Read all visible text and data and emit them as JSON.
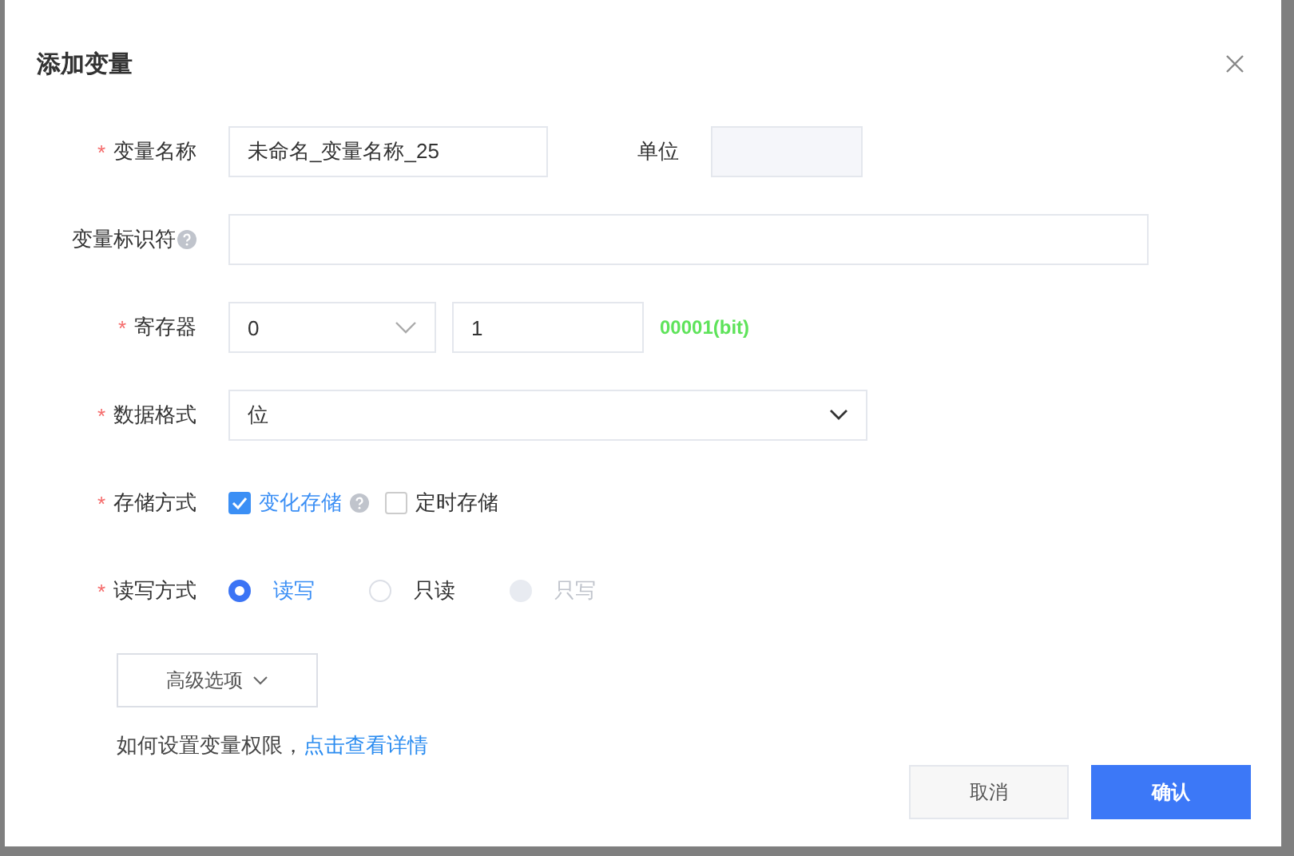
{
  "title": "添加变量",
  "rows": [
    {
      "kind": "text-unit",
      "label": "变量名称",
      "required_mark": "*",
      "value": "未命名_变量名称_25",
      "unit_label": "单位"
    },
    {
      "kind": "text",
      "label": "变量标识符",
      "help": true
    },
    {
      "kind": "register",
      "label": "寄存器",
      "required_mark": "*",
      "select_value": "0",
      "input_value": "1",
      "note": "00001(bit)"
    },
    {
      "kind": "select",
      "label": "数据格式",
      "required_mark": "*",
      "value": "位"
    },
    {
      "kind": "checkboxes",
      "label": "存储方式",
      "required_mark": "*",
      "options": [
        {
          "label": "变化存储",
          "checked": true,
          "help": true
        },
        {
          "label": "定时存储",
          "checked": false,
          "help": false
        }
      ]
    },
    {
      "kind": "radios",
      "label": "读写方式",
      "required_mark": "*",
      "options": [
        {
          "label": "读写",
          "selected": true,
          "disabled": false
        },
        {
          "label": "只读",
          "selected": false,
          "disabled": false
        },
        {
          "label": "只写",
          "selected": false,
          "disabled": true
        }
      ]
    }
  ],
  "advanced_button": "高级选项",
  "hint": {
    "text": "如何设置变量权限，",
    "link": "点击查看详情"
  },
  "buttons": [
    {
      "label": "取消",
      "kind": "secondary"
    },
    {
      "label": "确认",
      "kind": "primary"
    }
  ]
}
